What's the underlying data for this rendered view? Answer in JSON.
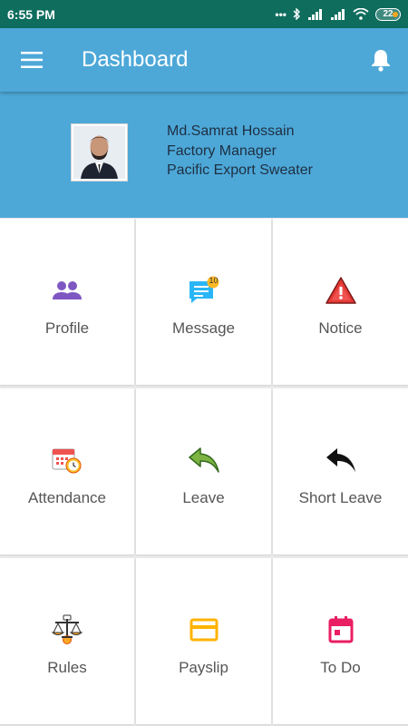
{
  "status_bar": {
    "time": "6:55 PM",
    "battery": "22"
  },
  "appbar": {
    "title": "Dashboard",
    "menu_icon": "hamburger-menu-icon",
    "bell_icon": "bell-icon"
  },
  "profile": {
    "name": "Md.Samrat Hossain",
    "designation": "Factory Manager",
    "company": "Pacific Export Sweater"
  },
  "tiles": [
    {
      "label": "Profile",
      "icon": "people-icon",
      "color": "#7e57c2"
    },
    {
      "label": "Message",
      "icon": "message-icon",
      "color": "#29b6f6",
      "badge": "10"
    },
    {
      "label": "Notice",
      "icon": "warning-icon",
      "color": "#e53935"
    },
    {
      "label": "Attendance",
      "icon": "calendar-clock-icon",
      "color": "#ef5350"
    },
    {
      "label": "Leave",
      "icon": "reply-green-icon",
      "color": "#7cb342"
    },
    {
      "label": "Short Leave",
      "icon": "reply-black-icon",
      "color": "#111111"
    },
    {
      "label": "Rules",
      "icon": "scales-icon",
      "color": "#f9a825"
    },
    {
      "label": "Payslip",
      "icon": "credit-card-icon",
      "color": "#ffb300"
    },
    {
      "label": "To Do",
      "icon": "calendar-icon",
      "color": "#e91e63"
    }
  ]
}
